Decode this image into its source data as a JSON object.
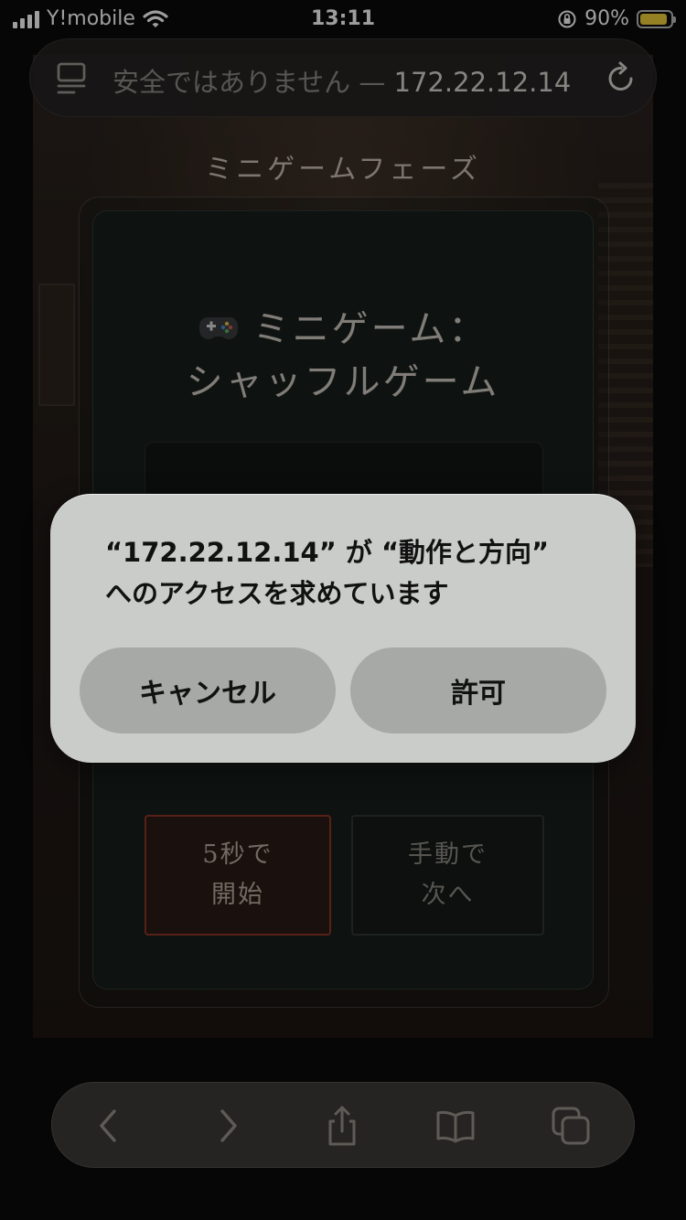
{
  "status_bar": {
    "carrier": "Y!mobile",
    "time": "13:11",
    "battery_percent": "90%",
    "battery_level": 0.9
  },
  "url_bar": {
    "security_label": "安全ではありません —",
    "host": "172.22.12.14"
  },
  "page": {
    "phase_title": "ミニゲームフェーズ",
    "game_title_line1": "ミニゲーム：",
    "game_title_line2": "シャッフルゲーム",
    "start_button_line1": "5秒で",
    "start_button_line2": "開始",
    "manual_button_line1": "手動で",
    "manual_button_line2": "次へ"
  },
  "dialog": {
    "message_line1": "“172.22.12.14” が “動作と方向”",
    "message_line2": "へのアクセスを求めています",
    "cancel_label": "キャンセル",
    "allow_label": "許可"
  },
  "colors": {
    "battery": "#f2cf3a",
    "start_button_border": "#8e3628",
    "dialog_background": "#c9ccc8"
  },
  "icons": [
    "signal-icon",
    "wifi-icon",
    "orientation-lock-icon",
    "battery-icon",
    "page-menu-icon",
    "reload-icon",
    "gamepad-icon",
    "back-icon",
    "forward-icon",
    "share-icon",
    "bookmarks-icon",
    "tabs-icon"
  ]
}
